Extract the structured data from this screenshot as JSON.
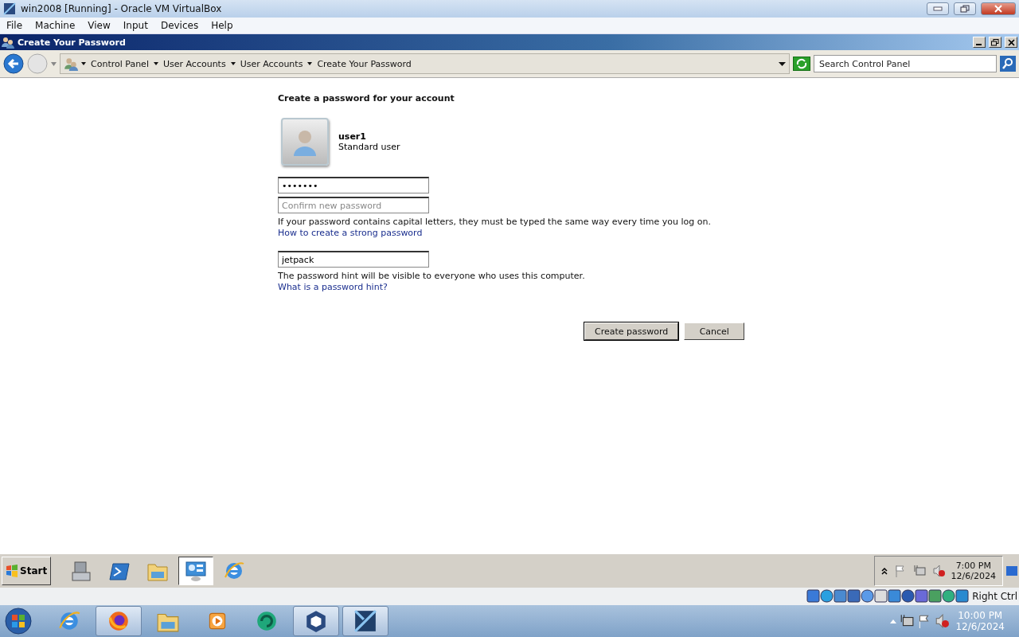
{
  "vbox": {
    "title": "win2008 [Running] - Oracle VM VirtualBox",
    "menu": [
      "File",
      "Machine",
      "View",
      "Input",
      "Devices",
      "Help"
    ]
  },
  "window": {
    "title": "Create Your Password"
  },
  "address_bar": {
    "breadcrumbs": [
      "Control Panel",
      "User Accounts",
      "User Accounts",
      "Create Your Password"
    ],
    "search": {
      "placeholder": "Search Control Panel"
    }
  },
  "content": {
    "heading": "Create a password for your account",
    "user": {
      "name": "user1",
      "type": "Standard user"
    },
    "new_password": {
      "value": "•••••••"
    },
    "confirm_password": {
      "placeholder": "Confirm new password"
    },
    "note": "If your password contains capital letters, they must be typed the same way every time you log on.",
    "link": "How to create a strong password",
    "hint": {
      "value": "jetpack"
    },
    "hint_note": "The password hint will be visible to everyone who uses this computer.",
    "hint_link": "What is a password hint?",
    "buttons": [
      {
        "label": "Create password",
        "default": true
      },
      {
        "label": "Cancel",
        "default": false
      }
    ]
  },
  "guest_taskbar": {
    "start": "Start",
    "buttons": [
      {
        "kind": "server",
        "selected": false
      },
      {
        "kind": "terminal",
        "selected": false
      },
      {
        "kind": "folder",
        "selected": false
      },
      {
        "kind": "control",
        "selected": true
      },
      {
        "kind": "ie",
        "selected": false
      }
    ],
    "clock": {
      "time": "7:00 PM",
      "date": "12/6/2024"
    }
  },
  "vbox_status": {
    "host_key": "Right Ctrl"
  },
  "host_taskbar": {
    "buttons": [
      {
        "kind": "ie",
        "selected": false
      },
      {
        "kind": "firefox",
        "selected": true
      },
      {
        "kind": "folder",
        "selected": false
      },
      {
        "kind": "media",
        "selected": false
      },
      {
        "kind": "swirl",
        "selected": false
      },
      {
        "kind": "cube",
        "selected": true
      },
      {
        "kind": "tile",
        "selected": true
      }
    ],
    "clock": {
      "time": "10:00 PM",
      "date": "12/6/2024"
    }
  }
}
